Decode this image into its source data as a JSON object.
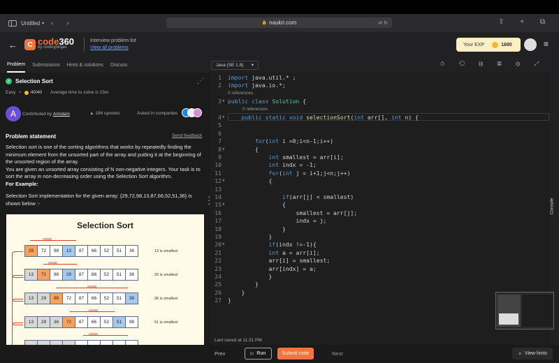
{
  "browser": {
    "tab_name": "Untitled",
    "url": "naukri.com"
  },
  "header": {
    "logo_main": "code",
    "logo_num": "360",
    "logo_by": "by codingninjas",
    "crumb_title": "Interview problem list",
    "crumb_link": "View all problems",
    "exp_label": "Your EXP",
    "exp_value": "1680"
  },
  "tabs": [
    "Problem",
    "Submissions",
    "Hints & solutions",
    "Discuss"
  ],
  "problem": {
    "title": "Selection Sort",
    "difficulty": "Easy",
    "score": "40/40",
    "avg_time": "Average time to solve is 15m",
    "contributed_prefix": "Contributed by",
    "contributor": "Arindam",
    "contributor_initial": "A",
    "upvotes": "194 upvotes",
    "asked_in": "Asked in companies",
    "statement_heading": "Problem statement",
    "feedback": "Send feedback",
    "para1": "Selection sort is one of the sorting algorithms that works by repeatedly finding the minimum element from the unsorted part of the array and putting it at the beginning of the unsorted region of the array.",
    "para2": "You are given an unsorted array consisting of N non-negative integers. Your task is to sort the array in non-decreasing order using the Selection Sort algorithm.",
    "for_example": "For Example:",
    "impl_text": "Selection Sort implementation for the given array:  {29,72,98,13,87,66,52,51,36}  is shown below :-"
  },
  "diagram": {
    "title": "Selection  Sort",
    "swap_label": "swap",
    "rows": [
      {
        "cells": [
          "29",
          "72",
          "98",
          "13",
          "87",
          "66",
          "52",
          "51",
          "36"
        ],
        "note": "13 is smallest"
      },
      {
        "cells": [
          "13",
          "72",
          "98",
          "29",
          "87",
          "66",
          "52",
          "51",
          "36"
        ],
        "note": "29 is smallest"
      },
      {
        "cells": [
          "13",
          "29",
          "98",
          "72",
          "87",
          "66",
          "52",
          "51",
          "36"
        ],
        "note": "36 is smallest"
      },
      {
        "cells": [
          "13",
          "29",
          "36",
          "72",
          "87",
          "66",
          "52",
          "51",
          "98"
        ],
        "note": "51 is smallest"
      }
    ]
  },
  "editor": {
    "language": "Java (SE 1.8)",
    "refs_label": "0 references",
    "last_saved": "Last saved at 11:31 PM",
    "console_label": "Console"
  },
  "code_lines": [
    "import java.util.* ;",
    "import java.io.*;",
    "public class Solution {",
    "    public static void selectionSort(int arr[], int n) {",
    "",
    "",
    "        for(int i =0;i<n-1;i++)",
    "        {",
    "            int smallest = arr[i];",
    "            int indx = -1;",
    "            for(int j = i+1;j<n;j++)",
    "            {",
    "",
    "                if(arr[j] < smallest)",
    "                {",
    "                    smallest = arr[j];",
    "                    indx = j;",
    "                }",
    "            }",
    "            if(indx !=-1){",
    "            int a = arr[i];",
    "            arr[i] = smallest;",
    "            arr[indx] = a;",
    "            }",
    "        }",
    "    }",
    "}"
  ],
  "bottom": {
    "prev": "Prev",
    "run": "Run",
    "submit": "Submit code",
    "next": "Next",
    "hints": "View hints"
  }
}
